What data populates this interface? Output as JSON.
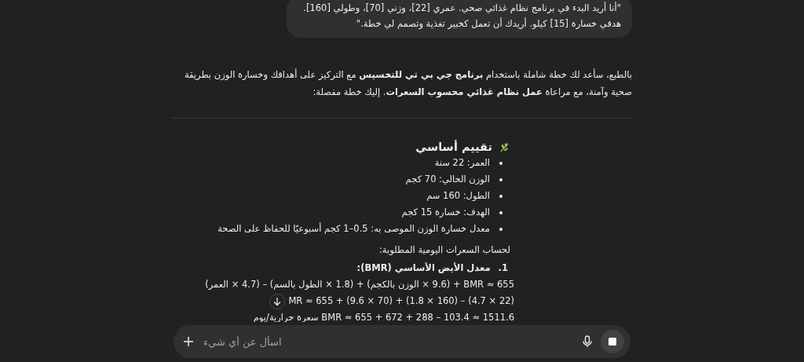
{
  "user_message": "\"أنا أريد البدء في برنامج نظام غذائي صحي. عمري [22]، وزني [70]، وطولي [160]. هدفي خسارة [15] كيلو. أريدك أن تعمل كخبير تغذية وتصمم لي خطة.\"",
  "reply": {
    "intro": "بالطبع، سأعد لك خطة شاملة باستخدام **برنامج جي بي تي للتخسيس** مع التركيز على أهدافك وخسارة الوزن بطريقة صحية وآمنة، مع مراعاة **عمل نظام غذائي محسوب السعرات**. إليك خطة مفصلة:",
    "section_title": "تقييم أساسي",
    "bullets": [
      "العمر: 22 سنة",
      "الوزن الحالي: 70 كجم",
      "الطول: 160 سم",
      "الهدف: خسارة 15 كجم",
      "معدل خسارة الوزن الموصى به: 0.5–1 كجم أسبوعيًا للحفاظ على الصحة"
    ],
    "calc_intro": "لحساب السعرات اليومية المطلوبة:",
    "steps": [
      {
        "number": "1.",
        "title": "معدل الأيض الأساسي (BMR):",
        "lines": [
          "BMR ≈ 655 + (9.6 × الوزن بالكجم) + (1.8 × الطول بالسم) – (4.7 × العمر)",
          "MR ≈ 655 + (9.6 × 70) + (1.8 × 160) – (4.7 × 22)",
          "BMR ≈ 655 + 672 + 288 – 103.4 ≈ 1511.6 سعرة حرارية/يوم"
        ]
      }
    ]
  },
  "composer": {
    "placeholder": "اسأل عن أي شيء"
  }
}
